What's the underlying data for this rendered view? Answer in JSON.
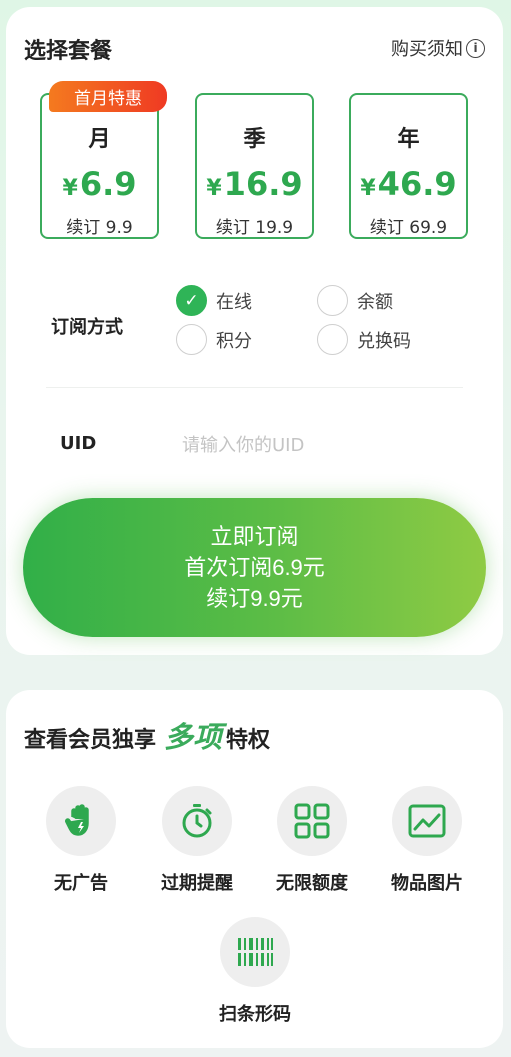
{
  "plan_section": {
    "title": "选择套餐",
    "notice_label": "购买须知",
    "info_glyph": "i",
    "badge": "首月特惠",
    "plans": [
      {
        "name": "月",
        "currency": "¥",
        "price": "6.9",
        "renew": "续订 9.9",
        "selected": true
      },
      {
        "name": "季",
        "currency": "¥",
        "price": "16.9",
        "renew": "续订 19.9",
        "selected": false
      },
      {
        "name": "年",
        "currency": "¥",
        "price": "46.9",
        "renew": "续订 69.9",
        "selected": false
      }
    ]
  },
  "subscription": {
    "label": "订阅方式",
    "options": [
      {
        "label": "在线",
        "checked": true
      },
      {
        "label": "余额",
        "checked": false
      },
      {
        "label": "积分",
        "checked": false
      },
      {
        "label": "兑换码",
        "checked": false
      }
    ]
  },
  "uid": {
    "label": "UID",
    "value": "",
    "placeholder": "请输入你的UID"
  },
  "subscribe_button": {
    "line1": "立即订阅",
    "line2": "首次订阅6.9元",
    "line3": "续订9.9元"
  },
  "privileges": {
    "title_prefix": "查看会员独享",
    "title_emphasis": "多项",
    "title_suffix": "特权",
    "items": [
      {
        "label": "无广告",
        "icon": "hand-stop-icon"
      },
      {
        "label": "过期提醒",
        "icon": "stopwatch-icon"
      },
      {
        "label": "无限额度",
        "icon": "grid-icon"
      },
      {
        "label": "物品图片",
        "icon": "image-chart-icon"
      },
      {
        "label": "扫条形码",
        "icon": "barcode-scan-icon"
      }
    ]
  },
  "colors": {
    "accent": "#3bab5c",
    "badge_start": "#f47a1f",
    "badge_end": "#ef3a23",
    "button_start": "#31af48",
    "button_end": "#8fcb44"
  }
}
